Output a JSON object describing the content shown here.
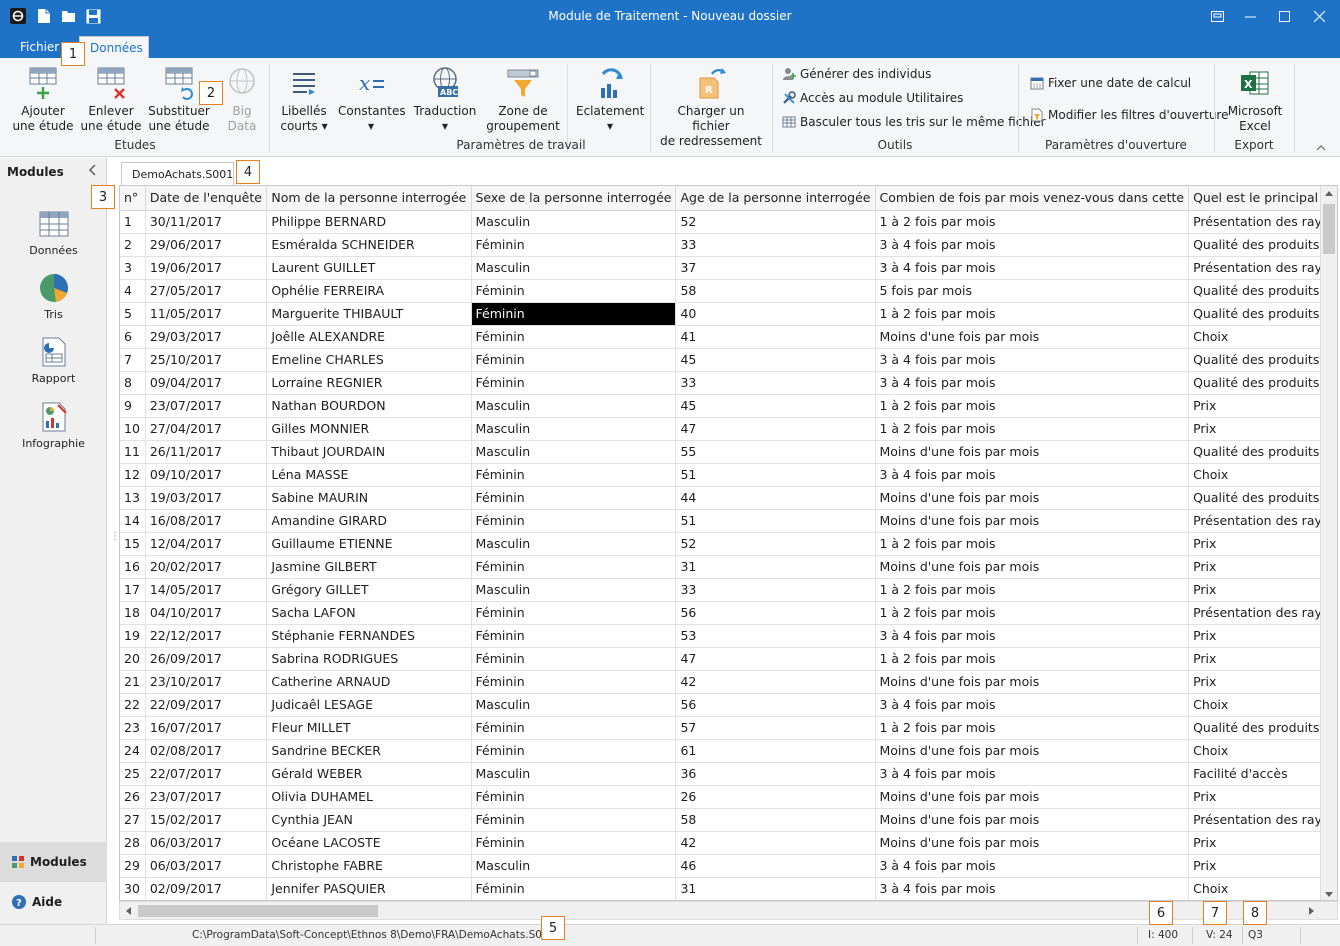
{
  "window": {
    "title": "Module de Traitement - Nouveau dossier"
  },
  "tabs": [
    "Fichier",
    "Données"
  ],
  "ribbon": {
    "etudes": {
      "label": "Etudes",
      "ajouter": [
        "Ajouter",
        "une étude"
      ],
      "enlever": [
        "Enlever",
        "une étude"
      ],
      "substituer": [
        "Substituer",
        "une étude"
      ],
      "bigdata": [
        "Big",
        "Data"
      ]
    },
    "parametres": {
      "label": "Paramètres de travail",
      "libelles": [
        "Libellés",
        "courts ▾"
      ],
      "constantes": [
        "Constantes",
        "▾"
      ],
      "traduction": [
        "Traduction",
        "▾"
      ],
      "zone": [
        "Zone de",
        "groupement"
      ],
      "eclatement": [
        "Eclatement",
        "▾"
      ],
      "charger": [
        "Charger un fichier",
        "de redressement"
      ]
    },
    "outils": {
      "label": "Outils",
      "generer": "Générer des individus",
      "acces": "Accès au module Utilitaires",
      "basculer": "Basculer tous les tris sur le même fichier"
    },
    "ouverture": {
      "label": "Paramètres d'ouverture",
      "fixer": "Fixer une date de calcul",
      "modifier": "Modifier les filtres d'ouverture"
    },
    "export": {
      "label": "Export",
      "excel": [
        "Microsoft",
        "Excel"
      ]
    }
  },
  "sidebar": {
    "title": "Modules",
    "items": [
      "Données",
      "Tris",
      "Rapport",
      "Infographie"
    ],
    "bottom_modules": "Modules",
    "bottom_aide": "Aide"
  },
  "doc_tab": "DemoAchats.S001",
  "grid": {
    "headers": [
      "n°",
      "Date de l'enquête",
      "Nom de la personne interrogée",
      "Sexe de la personne interrogée",
      "Age de la personne interrogée",
      "Combien de fois par mois venez-vous dans cette",
      "Quel est le principal p"
    ],
    "rows": [
      [
        "1",
        "30/11/2017",
        "Philippe BERNARD",
        "Masculin",
        "52",
        "1 à 2 fois par mois",
        "Présentation des rayo"
      ],
      [
        "2",
        "29/06/2017",
        "Esméralda SCHNEIDER",
        "Féminin",
        "33",
        "3 à 4 fois par mois",
        "Qualité des produits"
      ],
      [
        "3",
        "19/06/2017",
        "Laurent GUILLET",
        "Masculin",
        "37",
        "3 à 4 fois par mois",
        "Présentation des rayo"
      ],
      [
        "4",
        "27/05/2017",
        "Ophélie FERREIRA",
        "Féminin",
        "58",
        "5 fois par mois",
        "Qualité des produits"
      ],
      [
        "5",
        "11/05/2017",
        "Marguerite THIBAULT",
        "Féminin",
        "40",
        "1 à 2 fois par mois",
        "Qualité des produits"
      ],
      [
        "6",
        "29/03/2017",
        "Joêlle ALEXANDRE",
        "Féminin",
        "41",
        "Moins d'une fois par mois",
        "Choix"
      ],
      [
        "7",
        "25/10/2017",
        "Emeline CHARLES",
        "Féminin",
        "45",
        "3 à 4 fois par mois",
        "Qualité des produits"
      ],
      [
        "8",
        "09/04/2017",
        "Lorraine REGNIER",
        "Féminin",
        "33",
        "3 à 4 fois par mois",
        "Qualité des produits"
      ],
      [
        "9",
        "23/07/2017",
        "Nathan BOURDON",
        "Masculin",
        "45",
        "1 à 2 fois par mois",
        "Prix"
      ],
      [
        "10",
        "27/04/2017",
        "Gilles MONNIER",
        "Masculin",
        "47",
        "1 à 2 fois par mois",
        "Prix"
      ],
      [
        "11",
        "26/11/2017",
        "Thibaut JOURDAIN",
        "Masculin",
        "55",
        "Moins d'une fois par mois",
        "Qualité des produits"
      ],
      [
        "12",
        "09/10/2017",
        "Léna MASSE",
        "Féminin",
        "51",
        "3 à 4 fois par mois",
        "Choix"
      ],
      [
        "13",
        "19/03/2017",
        "Sabine MAURIN",
        "Féminin",
        "44",
        "Moins d'une fois par mois",
        "Qualité des produits"
      ],
      [
        "14",
        "16/08/2017",
        "Amandine GIRARD",
        "Féminin",
        "51",
        "Moins d'une fois par mois",
        "Présentation des rayo"
      ],
      [
        "15",
        "12/04/2017",
        "Guillaume ETIENNE",
        "Masculin",
        "52",
        "1 à 2 fois par mois",
        "Prix"
      ],
      [
        "16",
        "20/02/2017",
        "Jasmine GILBERT",
        "Féminin",
        "31",
        "Moins d'une fois par mois",
        "Prix"
      ],
      [
        "17",
        "14/05/2017",
        "Grégory GILLET",
        "Masculin",
        "33",
        "1 à 2 fois par mois",
        "Prix"
      ],
      [
        "18",
        "04/10/2017",
        "Sacha LAFON",
        "Féminin",
        "56",
        "1 à 2 fois par mois",
        "Présentation des rayo"
      ],
      [
        "19",
        "22/12/2017",
        "Stéphanie FERNANDES",
        "Féminin",
        "53",
        "3 à 4 fois par mois",
        "Prix"
      ],
      [
        "20",
        "26/09/2017",
        "Sabrina RODRIGUES",
        "Féminin",
        "47",
        "1 à 2 fois par mois",
        "Prix"
      ],
      [
        "21",
        "23/10/2017",
        "Catherine ARNAUD",
        "Féminin",
        "42",
        "Moins d'une fois par mois",
        "Prix"
      ],
      [
        "22",
        "22/09/2017",
        "Judicaêl LESAGE",
        "Masculin",
        "56",
        "3 à 4 fois par mois",
        "Choix"
      ],
      [
        "23",
        "16/07/2017",
        "Fleur MILLET",
        "Féminin",
        "57",
        "1 à 2 fois par mois",
        "Qualité des produits"
      ],
      [
        "24",
        "02/08/2017",
        "Sandrine BECKER",
        "Féminin",
        "61",
        "Moins d'une fois par mois",
        "Choix"
      ],
      [
        "25",
        "22/07/2017",
        "Gérald WEBER",
        "Masculin",
        "36",
        "3 à 4 fois par mois",
        "Facilité d'accès"
      ],
      [
        "26",
        "23/07/2017",
        "Olivia DUHAMEL",
        "Féminin",
        "26",
        "Moins d'une fois par mois",
        "Prix"
      ],
      [
        "27",
        "15/02/2017",
        "Cynthia JEAN",
        "Féminin",
        "58",
        "Moins d'une fois par mois",
        "Présentation des rayo"
      ],
      [
        "28",
        "06/03/2017",
        "Océane LACOSTE",
        "Féminin",
        "42",
        "Moins d'une fois par mois",
        "Prix"
      ],
      [
        "29",
        "06/03/2017",
        "Christophe FABRE",
        "Masculin",
        "46",
        "3 à 4 fois par mois",
        "Prix"
      ],
      [
        "30",
        "02/09/2017",
        "Jennifer PASQUIER",
        "Féminin",
        "31",
        "3 à 4 fois par mois",
        "Choix"
      ]
    ],
    "selected": {
      "row": 4,
      "col": 3
    }
  },
  "statusbar": {
    "path": "C:\\ProgramData\\Soft-Concept\\Ethnos 8\\Demo\\FRA\\DemoAchats.S001",
    "individus": "I: 400",
    "variables": "V: 24",
    "question": "Q3"
  },
  "callouts": [
    "1",
    "2",
    "3",
    "4",
    "5",
    "6",
    "7",
    "8"
  ],
  "colors": {
    "accent": "#1e73c7",
    "callout_border": "#e67e22",
    "excel_green": "#1e7145"
  }
}
